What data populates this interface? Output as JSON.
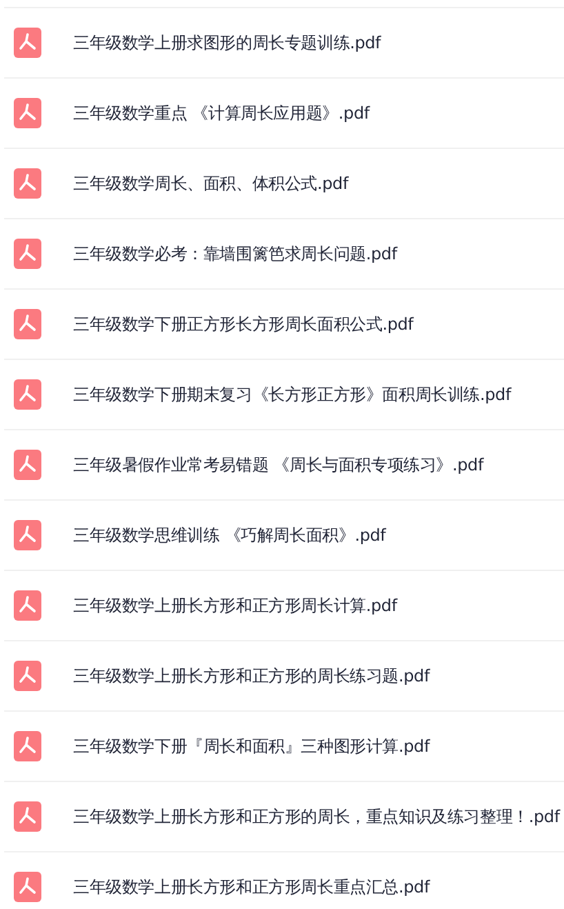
{
  "files": [
    {
      "name": "三年级数学上册求图形的周长专题训练.pdf"
    },
    {
      "name": "三年级数学重点 《计算周长应用题》.pdf"
    },
    {
      "name": "三年级数学周长、面积、体积公式.pdf"
    },
    {
      "name": "三年级数学必考：靠墙围篱笆求周长问题.pdf"
    },
    {
      "name": "三年级数学下册正方形长方形周长面积公式.pdf"
    },
    {
      "name": "三年级数学下册期末复习《长方形正方形》面积周长训练.pdf"
    },
    {
      "name": "三年级暑假作业常考易错题 《周长与面积专项练习》.pdf"
    },
    {
      "name": "三年级数学思维训练 《巧解周长面积》.pdf"
    },
    {
      "name": "三年级数学上册长方形和正方形周长计算.pdf"
    },
    {
      "name": "三年级数学上册长方形和正方形的周长练习题.pdf"
    },
    {
      "name": "三年级数学下册『周长和面积』三种图形计算.pdf"
    },
    {
      "name": "三年级数学上册长方形和正方形的周长，重点知识及练习整理！.pdf"
    },
    {
      "name": "三年级数学上册长方形和正方形周长重点汇总.pdf"
    }
  ]
}
